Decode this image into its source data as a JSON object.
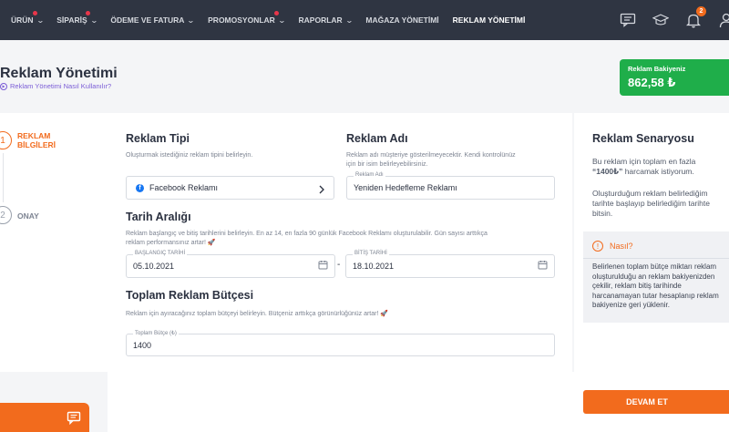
{
  "nav": {
    "items": [
      {
        "label": "ÜRÜN",
        "dropdown": true,
        "dot": true
      },
      {
        "label": "SİPARİŞ",
        "dropdown": true,
        "dot": true
      },
      {
        "label": "ÖDEME VE FATURA",
        "dropdown": true,
        "dot": false
      },
      {
        "label": "PROMOSYONLAR",
        "dropdown": true,
        "dot": true
      },
      {
        "label": "RAPORLAR",
        "dropdown": true,
        "dot": false
      },
      {
        "label": "MAĞAZA YÖNETİMİ",
        "dropdown": false,
        "dot": false
      },
      {
        "label": "REKLAM YÖNETİMİ",
        "dropdown": false,
        "dot": false,
        "active": true
      }
    ],
    "icons": [
      "chat-icon",
      "education-icon",
      "bell-icon",
      "user-icon"
    ],
    "notification_count": "2"
  },
  "header": {
    "title": "Reklam Yönetimi",
    "help_link": "Reklam Yönetimi Nasıl Kullanılır?",
    "balance_label": "Reklam Bakiyeniz",
    "balance_value": "862,58 ₺"
  },
  "steps": [
    {
      "number": "1",
      "label_line1": "REKLAM",
      "label_line2": "BİLGİLERİ"
    },
    {
      "number": "2",
      "label_line1": "ONAY"
    }
  ],
  "form": {
    "ad_type": {
      "title": "Reklam Tipi",
      "description": "Oluşturmak istediğiniz reklam tipini belirleyin.",
      "value": "Facebook Reklamı"
    },
    "ad_name": {
      "title": "Reklam Adı",
      "description_line1": "Reklam adı müşteriye gösterilmeyecektir. Kendi kontrolünüz",
      "description_line2": "için bir isim belirleyebilirsiniz.",
      "field_label": "Reklam Adı",
      "value": "Yeniden Hedefleme Reklamı"
    },
    "date_range": {
      "title": "Tarih Aralığı",
      "description_line1": "Reklam başlangıç ve bitiş tarihlerini belirleyin. En az 14, en fazla 90 günlük Facebook Reklamı oluşturulabilir. Gün sayısı arttıkça",
      "description_line2": "reklam performansınız artar! 🚀",
      "start_label": "BAŞLANGIÇ TARİHİ",
      "start_value": "05.10.2021",
      "separator": "-",
      "end_label": "BİTİŞ TARİHİ",
      "end_value": "18.10.2021"
    },
    "budget": {
      "title": "Toplam Reklam Bütçesi",
      "description": "Reklam için ayıracağınız toplam bütçeyi belirleyin. Bütçeniz arttıkça görünürlüğünüz artar! 🚀",
      "field_label": "Toplam Bütçe (₺)",
      "value": "1400"
    }
  },
  "scenario": {
    "title": "Reklam Senaryosu",
    "text1_line1": "Bu reklam için toplam en fazla",
    "text1_bold": "“1400₺”",
    "text1_rest": " harcamak istiyorum.",
    "text2": "Oluşturduğum reklam belirlediğim tarihte başlayıp belirlediğim tarihte bitsin.",
    "how_title": "Nasıl?",
    "how_text": "Belirlenen toplam bütçe miktarı reklam oluşturulduğu an reklam bakiyenizden çekilir, reklam bitiş tarihinde harcanamayan tutar hesaplanıp reklam bakiyenize geri yüklenir."
  },
  "footer": {
    "next_button": "DEVAM ET"
  },
  "colors": {
    "nav_bg": "#2f3542",
    "accent": "#f26b1d",
    "balance_bg": "#1fae4a",
    "facebook": "#1877f2"
  }
}
